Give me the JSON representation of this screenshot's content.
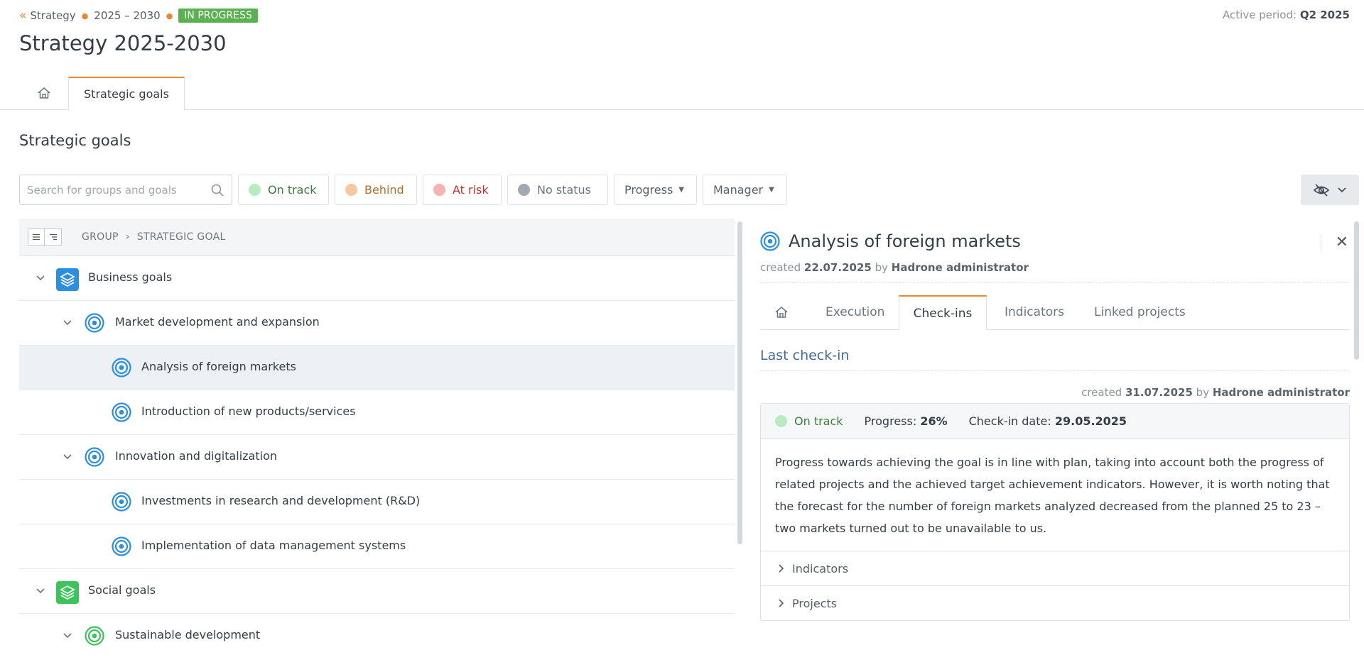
{
  "breadcrumb": {
    "root": "Strategy",
    "period": "2025 – 2030",
    "status": "IN PROGRESS"
  },
  "active_period": {
    "label": "Active period:",
    "value": "Q2 2025"
  },
  "page_title": "Strategy 2025-2030",
  "tabs": {
    "strategic_goals": "Strategic goals"
  },
  "section_title": "Strategic goals",
  "filters": {
    "search_placeholder": "Search for groups and goals",
    "on_track": "On track",
    "behind": "Behind",
    "at_risk": "At risk",
    "no_status": "No status",
    "progress": "Progress",
    "manager": "Manager"
  },
  "colors": {
    "accent": "#e8892f",
    "on_track": "#b9ebc0",
    "behind": "#f7c79e",
    "at_risk": "#f6b2ae",
    "no_status": "#a3a9b0",
    "business_group": "#2a8fe0",
    "social_group": "#3bc45a"
  },
  "tree": {
    "header": {
      "group": "GROUP",
      "goal": "STRATEGIC GOAL"
    },
    "rows": [
      {
        "label": "Business goals"
      },
      {
        "label": "Market development and expansion"
      },
      {
        "label": "Analysis of foreign markets"
      },
      {
        "label": "Introduction of new products/services"
      },
      {
        "label": "Innovation and digitalization"
      },
      {
        "label": "Investments in research and development (R&D)"
      },
      {
        "label": "Implementation of data management systems"
      },
      {
        "label": "Social goals"
      },
      {
        "label": "Sustainable development"
      }
    ]
  },
  "detail": {
    "title": "Analysis of foreign markets",
    "created_label": "created",
    "created_date": "22.07.2025",
    "by_label": "by",
    "created_by": "Hadrone administrator",
    "tabs": {
      "execution": "Execution",
      "checkins": "Check-ins",
      "indicators": "Indicators",
      "linked_projects": "Linked projects"
    },
    "last_checkin": "Last check-in",
    "checkin": {
      "created_label": "created",
      "created_date": "31.07.2025",
      "by_label": "by",
      "created_by": "Hadrone administrator",
      "status": "On track",
      "progress_label": "Progress:",
      "progress_value": "26%",
      "date_label": "Check-in date:",
      "date_value": "29.05.2025",
      "comment": "Progress towards achieving the goal is in line with plan, taking into account both the progress of related projects and the achieved target achievement indicators. However, it is worth noting that the forecast for the number of foreign markets analyzed decreased from the planned 25 to 23 – two markets turned out to be unavailable to us.",
      "indicators": "Indicators",
      "projects": "Projects"
    }
  }
}
